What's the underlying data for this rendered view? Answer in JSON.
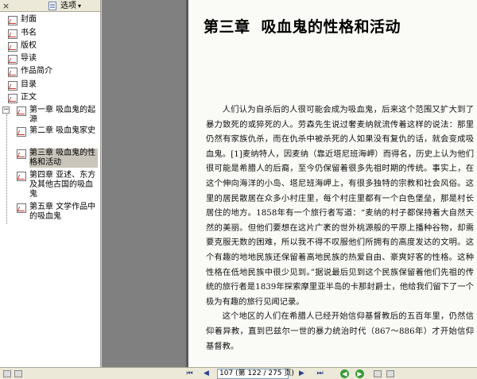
{
  "bookmarks_pane": {
    "options_label": "选项",
    "options_arrow": "▾",
    "close_glyph": "×",
    "items": [
      {
        "label": "封面"
      },
      {
        "label": "书名"
      },
      {
        "label": "版权"
      },
      {
        "label": "导读"
      },
      {
        "label": "作品简介"
      },
      {
        "label": "目录"
      },
      {
        "label": "正文"
      },
      {
        "label": "第一章  吸血鬼的起源"
      },
      {
        "label": "第二章  吸血鬼家史"
      },
      {
        "label": "第三章  吸血鬼的性格和活动"
      },
      {
        "label": "第四章  亚述、东方及其他古国的吸血鬼"
      },
      {
        "label": "第五章  文学作品中的吸血鬼"
      }
    ],
    "expander_glyph": "−"
  },
  "page": {
    "title_chapter": "第三章",
    "title_text": "吸血鬼的性格和活动",
    "paragraph1": "人们认为自杀后的人很可能会成为吸血鬼，后来这个范围又扩大到了暴力致死的或猝死的人。劳森先生说过奢麦纳就流传着这样的说法：那里仍然有家族仇杀，而在仇杀中被杀死的人如果没有复仇的话，就会变成吸血鬼。[1]麦纳特人，因麦纳（靠近塔尼班海岬）而得名，历史上认为他们很可能是希腊人的后裔，至今仍保留着很多先祖时期的传统。事实上，在这个伸向海洋的小岛、塔尼班海岬上，有很多独特的宗教和社会风俗。这里的居民散居在众多小村庄里，每个村庄里都有一个白色堡垒，那是村长居住的地方。1858年有一个旅行者写道：“麦纳的村子都保持着大自然天然的美丽。但他们要想在这片广袤的世外桃源般的平原上播种谷物，却需要克服无数的困难，所以我不得不叹服他们所拥有的高度发达的文明。这个有趣的地地民族还保留着高地民族的热爱自由、豪爽好客的性格。这种性格在低地民族中很少见到。”据说最后见到这个民族保留着他们先祖的传统的旅行者是1839年探索摩里亚半岛的卡那封爵士，他给我们留下了一个极为有趣的旅行见闻记录。",
    "paragraph2": "这个地区的人们在希腊人已经开始信仰基督教后的五百年里，仍然信仰着异教，直到巴兹尔一世的暴力统治时代（867～886年）才开始信仰基督教。"
  },
  "navbar": {
    "first_glyph": "⏮",
    "prev_glyph": "◀",
    "next_glyph": "▶",
    "last_glyph": "⏭",
    "page_field": "107 (第 122 / 275 页)",
    "back_glyph": "◀",
    "forward_glyph": "▶"
  }
}
